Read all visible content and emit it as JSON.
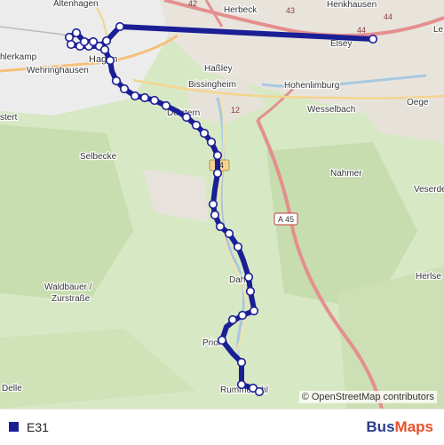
{
  "map": {
    "place_labels": {
      "altenhagen": "Altenhagen",
      "herbeck": "Herbeck",
      "henkhausen": "Henkhausen",
      "elsey": "Elsey",
      "ahlerkamp": "hlerkamp",
      "wehringhausen": "Wehringhausen",
      "hagen": "Hagen",
      "hassley": "Haßley",
      "bissingheim": "Bissingheim",
      "hohenlimburg": "Hohenlimburg",
      "oege": "Oege",
      "lette": "Le",
      "stert": "stert",
      "wesselbach": "Wesselbach",
      "delstern": "Delstern",
      "selbecke": "Selbecke",
      "nahmer": "Nahmer",
      "veserde": "Veserde",
      "waldbauer": "Waldbauer /",
      "zurstrasse": "Zurstraße",
      "dahl": "Dahl",
      "herlse": "Herlse",
      "priorei": "Priorei",
      "rummenohl": "Rummenohl",
      "delle": "Delle"
    },
    "road_labels": {
      "a45": "A 45",
      "r42": "42",
      "r43": "43",
      "r44a": "44",
      "r44b": "44",
      "r12": "12",
      "r54": "54"
    },
    "attribution": "OpenStreetMap contributors",
    "attribution_copy": "©"
  },
  "route": {
    "name": "E31",
    "color": "#1a1f96",
    "stop_count": 40
  },
  "brand": {
    "part1": "Bus",
    "part2": "Maps"
  }
}
